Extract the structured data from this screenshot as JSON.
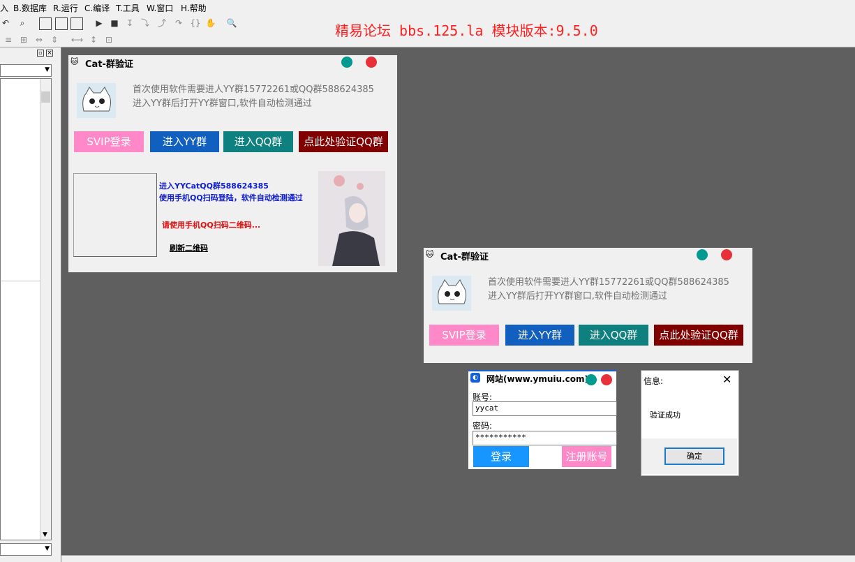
{
  "menu": [
    "入",
    "B.数据库",
    "R.运行",
    "C.编译",
    "T.工具",
    "W.窗口",
    "H.帮助"
  ],
  "banner": "精易论坛 bbs.125.la 模块版本:9.5.0",
  "colors": {
    "svip": "#ff88c8",
    "yy": "#1160c0",
    "qq": "#0f8080",
    "verify": "#800000",
    "dot_teal": "#009a90",
    "dot_red": "#e8303a",
    "login_blue": "#1796ff"
  },
  "dialog1": {
    "title": "Cat-群验证",
    "line1": "首次使用软件需要进人YY群15772261或QQ群588624385",
    "line2": "进入YY群后打开YY群窗口,软件自动检测通过",
    "btn_svip": "SVIP登录",
    "btn_yy": "进入YY群",
    "btn_qq": "进入QQ群",
    "btn_verify": "点此处验证QQ群",
    "qr_line1": "进入YYCatQQ群588624385",
    "qr_line2": "使用手机QQ扫码登陆，软件自动检测通过",
    "qr_hint": "请使用手机QQ扫码二维码...",
    "refresh": "刷新二维码"
  },
  "dialog2": {
    "title": "Cat-群验证",
    "line1": "首次使用软件需要进人YY群15772261或QQ群588624385",
    "line2": "进入YY群后打开YY群窗口,软件自动检测通过",
    "btn_svip": "SVIP登录",
    "btn_yy": "进入YY群",
    "btn_qq": "进入QQ群",
    "btn_verify": "点此处验证QQ群"
  },
  "login": {
    "title": "网站(www.ymuiu.com)",
    "account_label": "账号:",
    "account_value": "yycat",
    "password_label": "密码:",
    "password_value": "***********",
    "login_btn": "登录",
    "register_btn": "注册账号"
  },
  "msgbox": {
    "title": "信息:",
    "message": "验证成功",
    "ok": "确定"
  }
}
